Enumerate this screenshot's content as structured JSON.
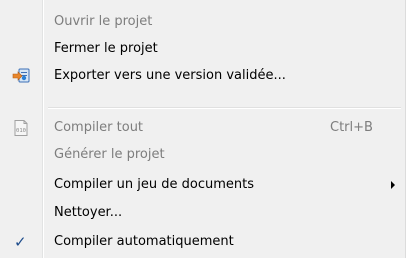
{
  "menu": {
    "items": [
      {
        "label": "Ouvrir le projet",
        "enabled": false
      },
      {
        "label": "Fermer le projet",
        "enabled": true
      },
      {
        "label": "Exporter vers une version validée...",
        "enabled": true,
        "icon": "export-icon"
      },
      {
        "label": "Compiler tout",
        "enabled": false,
        "shortcut": "Ctrl+B",
        "icon": "binary-file-icon"
      },
      {
        "label": "Générer le projet",
        "enabled": false
      },
      {
        "label": "Compiler un jeu de documents",
        "enabled": true,
        "submenu": true
      },
      {
        "label": "Nettoyer...",
        "enabled": true
      },
      {
        "label": "Compiler automatiquement",
        "enabled": true,
        "checked": true
      }
    ]
  },
  "icons": {
    "binary_text": "010"
  },
  "colors": {
    "menu_background": "#f0f0f0",
    "disabled_text": "#7d7d7d",
    "checkmark": "#1f4d8c"
  }
}
